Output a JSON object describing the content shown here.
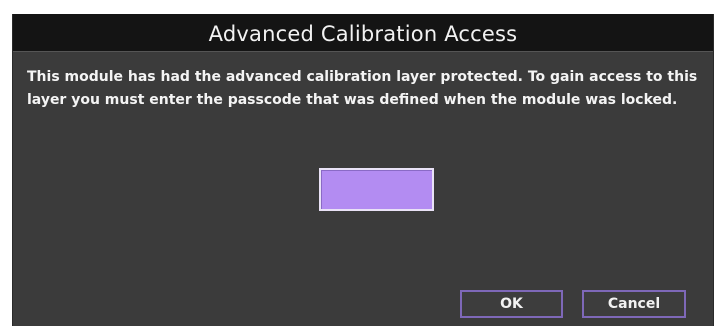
{
  "dialog": {
    "title": "Advanced Calibration Access",
    "message": "This module has had the advanced calibration layer protected. To gain access to this layer you must enter the passcode that was defined when the module was locked.",
    "passcode_value": "",
    "ok_label": "OK",
    "cancel_label": "Cancel"
  },
  "colors": {
    "dialog_background": "#3b3b3b",
    "titlebar_background": "#141414",
    "input_fill": "#b38cf2",
    "button_border": "#7e68b8"
  }
}
